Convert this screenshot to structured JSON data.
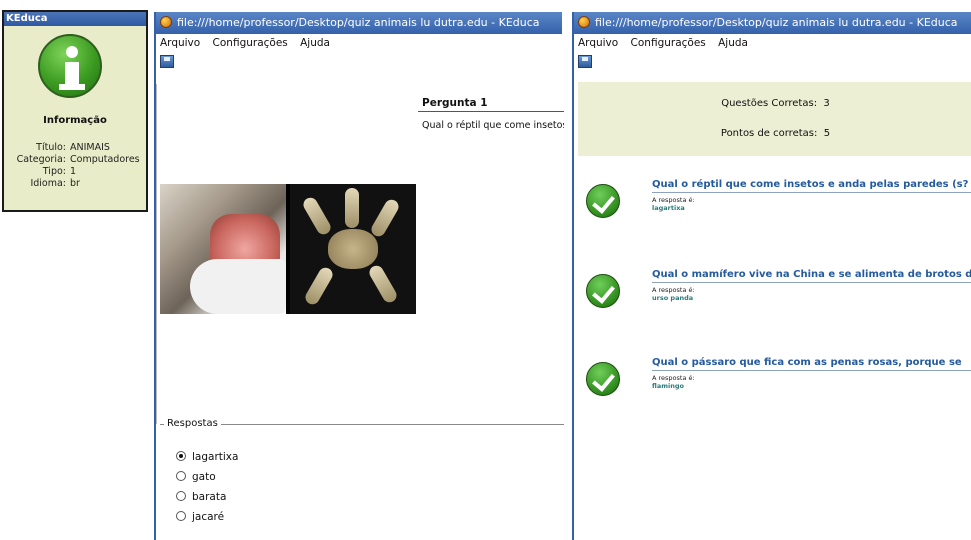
{
  "info": {
    "title": "KEduca",
    "heading": "Informação",
    "rows": [
      {
        "k": "Título:",
        "v": "ANIMAIS"
      },
      {
        "k": "Categoria:",
        "v": "Computadores"
      },
      {
        "k": "Tipo:",
        "v": "1"
      },
      {
        "k": "Idioma:",
        "v": "br"
      }
    ]
  },
  "mid": {
    "title": "file:///home/professor/Desktop/quiz animais lu dutra.edu - KEduca",
    "menu": {
      "arquivo": "Arquivo",
      "config": "Configurações",
      "ajuda": "Ajuda"
    },
    "question_heading": "Pergunta 1",
    "question_text": "Qual o réptil que come insetos e anda pelas paredes?",
    "responses_legend": "Respostas",
    "responses": [
      "lagartixa",
      "gato",
      "barata",
      "jacaré"
    ],
    "selected": 0
  },
  "right": {
    "title": "file:///home/professor/Desktop/quiz animais lu dutra.edu - KEduca",
    "menu": {
      "arquivo": "Arquivo",
      "config": "Configurações",
      "ajuda": "Ajuda"
    },
    "correct_label": "Questões Corretas:",
    "correct_value": "3",
    "points_label": "Pontos de corretas:",
    "points_value": "5",
    "results": [
      {
        "q": "Qual o réptil que come insetos e anda pelas paredes (s?",
        "label": "A resposta é:",
        "answer": "lagartixa"
      },
      {
        "q": "Qual o mamífero vive na China e se alimenta de brotos de",
        "label": "A resposta é:",
        "answer": "urso panda"
      },
      {
        "q": "Qual o pássaro que fica com as penas rosas, porque se",
        "label": "A resposta é:",
        "answer": "flamingo"
      }
    ]
  }
}
